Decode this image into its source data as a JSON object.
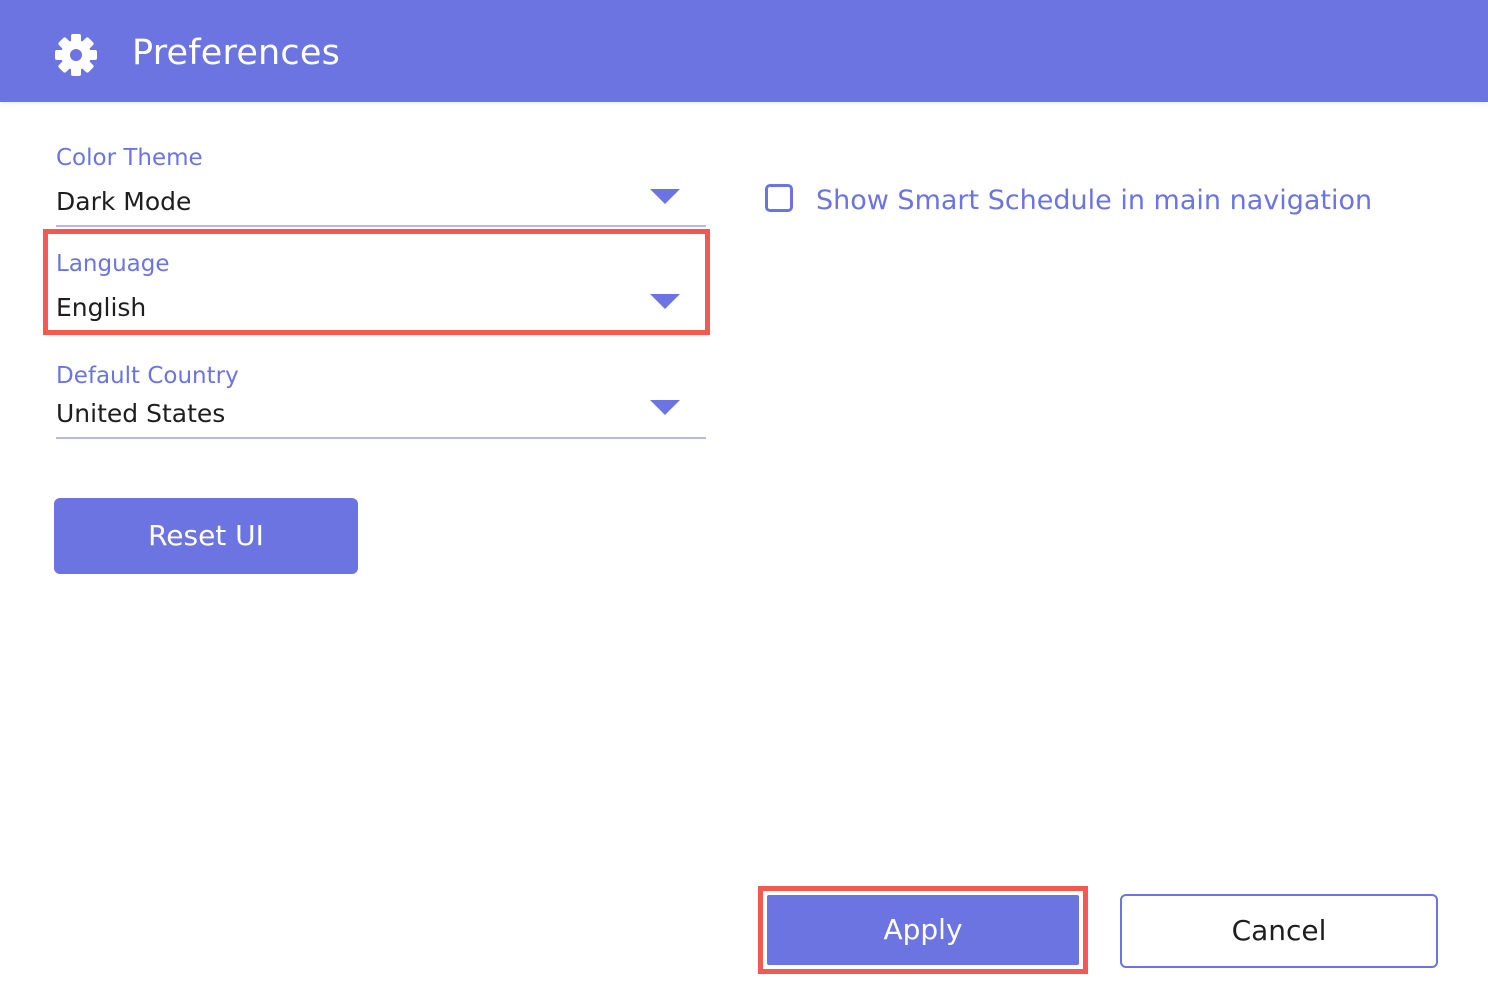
{
  "header": {
    "title": "Preferences",
    "icon": "gear-icon"
  },
  "fields": {
    "color_theme": {
      "label": "Color Theme",
      "value": "Dark Mode"
    },
    "language": {
      "label": "Language",
      "value": "English"
    },
    "default_country": {
      "label": "Default Country",
      "value": "United States"
    }
  },
  "options": {
    "smart_schedule": {
      "label": "Show Smart Schedule in main navigation",
      "checked": false
    }
  },
  "buttons": {
    "reset": "Reset UI",
    "apply": "Apply",
    "cancel": "Cancel"
  },
  "colors": {
    "accent": "#6b74e0",
    "highlight": "#f25a4f",
    "underline": "#b4b9f0",
    "text": "#1e1e1e"
  }
}
